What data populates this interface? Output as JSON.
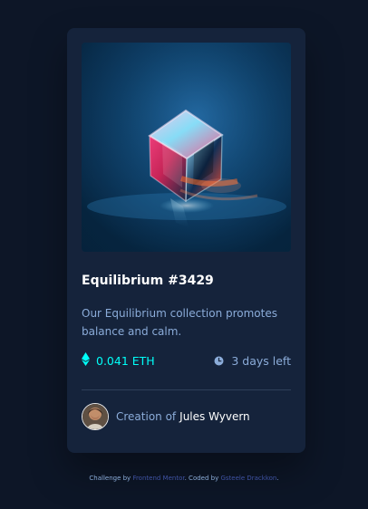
{
  "card": {
    "image_alt": "Equilibrium cube artwork",
    "title": "Equilibrium #3429",
    "description": "Our Equilibrium collection promotes balance and calm.",
    "price": "0.041 ETH",
    "time_left": "3 days left",
    "creator_prefix": "Creation of",
    "creator_name": "Jules Wyvern",
    "icons": {
      "price": "ethereum-icon",
      "time": "clock-icon"
    }
  },
  "attribution": {
    "prefix": "Challenge by",
    "challenge_link": "Frontend Mentor",
    "middle": ". Coded by",
    "author_link": "Gsteele Drackkon",
    "suffix": "."
  },
  "colors": {
    "page_bg": "#0d1627",
    "card_bg": "#15233b",
    "accent_cyan": "#00fff8",
    "soft_blue": "#8bacd9",
    "link_blue": "#3e52a3",
    "divider": "#2e405a"
  }
}
